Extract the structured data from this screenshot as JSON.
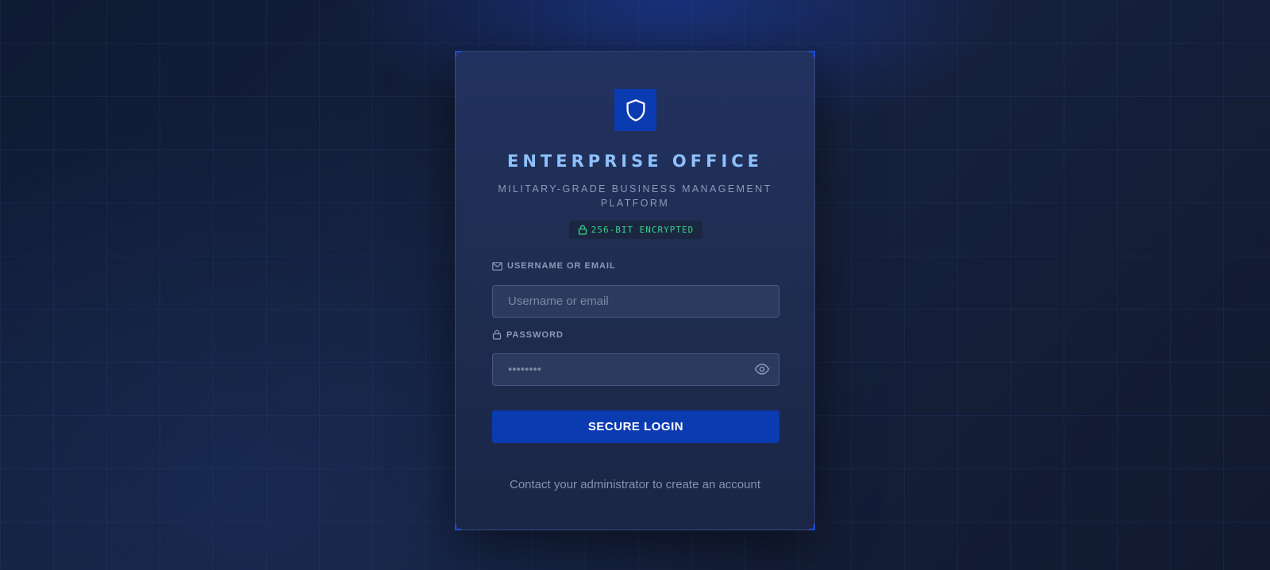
{
  "app": {
    "title": "ENTERPRISE OFFICE",
    "subtitle": "MILITARY-GRADE BUSINESS MANAGEMENT PLATFORM",
    "logo_icon": "shield-icon"
  },
  "badge": {
    "icon": "lock-icon",
    "text": "256-BIT ENCRYPTED",
    "color": "#3ccf8e"
  },
  "form": {
    "username": {
      "icon": "mail-icon",
      "label": "USERNAME OR EMAIL",
      "placeholder": "Username or email",
      "value": ""
    },
    "password": {
      "icon": "lock-icon",
      "label": "PASSWORD",
      "placeholder": "••••••••",
      "value": "",
      "toggle_icon": "eye-icon"
    },
    "submit_label": "SECURE LOGIN"
  },
  "footer": {
    "text": "Contact your administrator to create an account"
  },
  "colors": {
    "accent": "#0a3bb0",
    "title": "#8ec0ff",
    "background": "#16213d"
  }
}
